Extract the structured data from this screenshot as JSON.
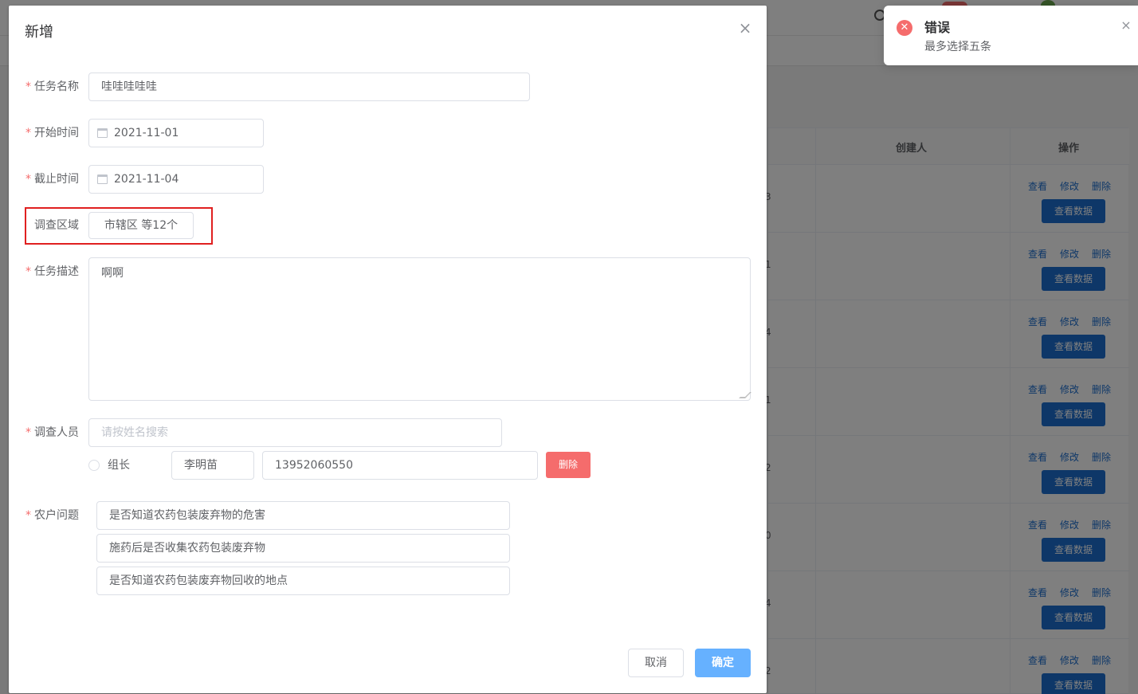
{
  "dialog": {
    "title": "新增",
    "fields": {
      "task_name": {
        "label": "任务名称",
        "value": "哇哇哇哇哇"
      },
      "start_time": {
        "label": "开始时间",
        "value": "2021-11-01"
      },
      "end_time": {
        "label": "截止时间",
        "value": "2021-11-04"
      },
      "survey_area": {
        "label": "调查区域",
        "value": "市辖区 等12个"
      },
      "task_desc": {
        "label": "任务描述",
        "value": "啊啊"
      },
      "surveyor": {
        "label": "调查人员",
        "placeholder": "请按姓名搜索",
        "member": {
          "role": "组长",
          "name": "李明苗",
          "phone": "13952060550",
          "delete_label": "删除"
        }
      },
      "farmer_questions": {
        "label": "农户问题",
        "items": [
          "是否知道农药包装废弃物的危害",
          "施药后是否收集农药包装废弃物",
          "是否知道农药包装废弃物回收的地点"
        ]
      }
    },
    "buttons": {
      "cancel": "取消",
      "confirm": "确定"
    }
  },
  "notification": {
    "title": "错误",
    "message": "最多选择五条",
    "type": "error"
  },
  "background_table": {
    "headers": {
      "creator": "创建人",
      "actions": "操作"
    },
    "row_numbers": [
      "3",
      "1",
      "4",
      "1",
      "2",
      "0",
      "4",
      "2"
    ],
    "actions": {
      "view": "查看",
      "edit": "修改",
      "delete": "删除",
      "view_data": "查看数据"
    }
  },
  "colors": {
    "danger": "#f56c6c",
    "primary_light": "#66b1ff",
    "link": "#1c6fd1",
    "highlight_border": "#e02020"
  }
}
